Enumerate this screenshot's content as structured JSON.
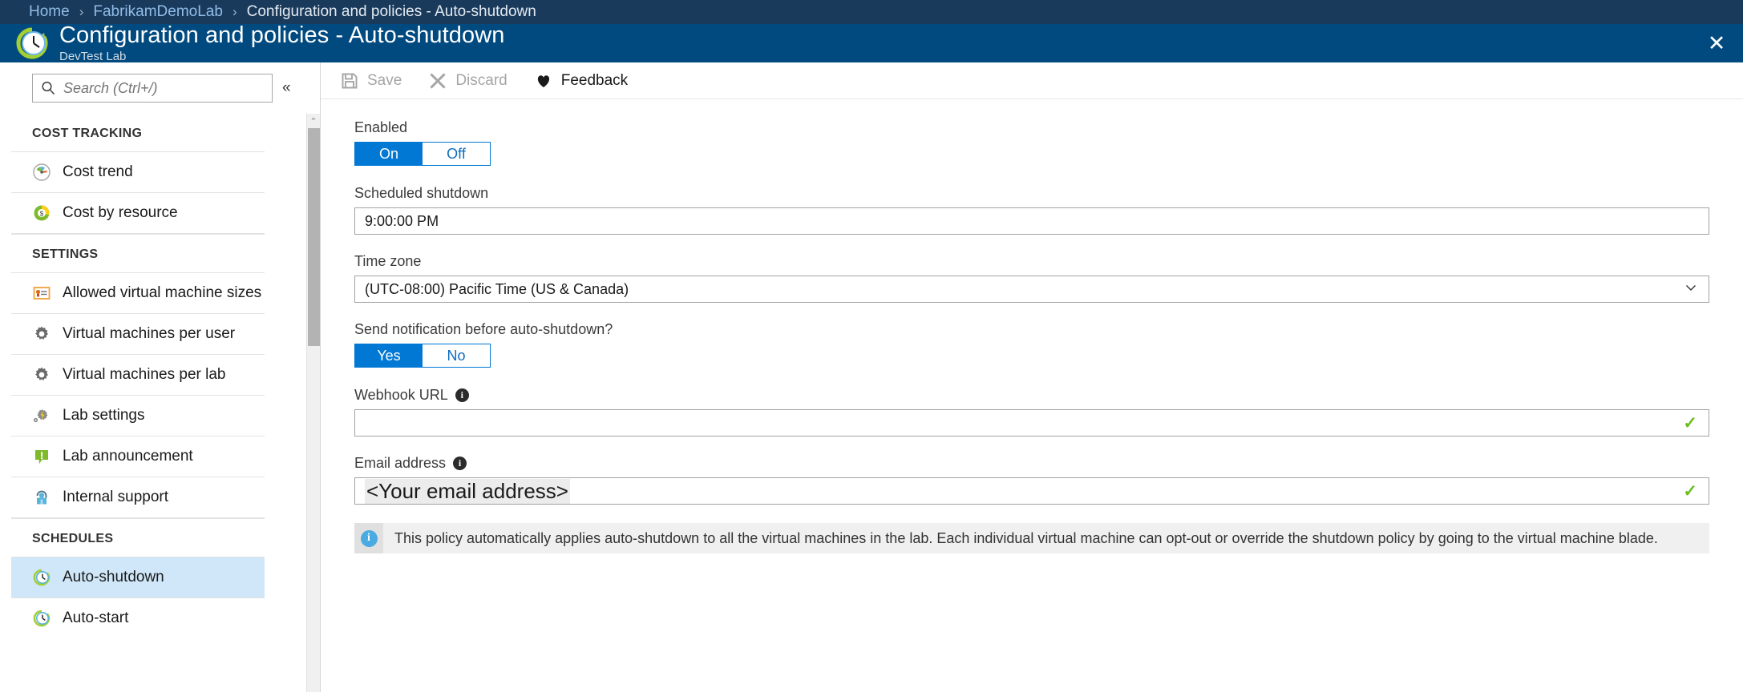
{
  "breadcrumb": {
    "items": [
      "Home",
      "FabrikamDemoLab",
      "Configuration and policies - Auto-shutdown"
    ],
    "separator": "›"
  },
  "header": {
    "title": "Configuration and policies - Auto-shutdown",
    "subtitle": "DevTest Lab",
    "icon": "clock-refresh-icon",
    "close_label": "✕"
  },
  "sidebar": {
    "search": {
      "placeholder": "Search (Ctrl+/)",
      "value": "",
      "icon": "search-icon"
    },
    "collapse_label": "«",
    "scroll_up_label": "⌃",
    "groups": [
      {
        "title": "COST TRACKING",
        "items": [
          {
            "label": "Cost trend",
            "icon": "cost-trend-icon",
            "selected": false
          },
          {
            "label": "Cost by resource",
            "icon": "cost-by-resource-icon",
            "selected": false
          }
        ]
      },
      {
        "title": "SETTINGS",
        "items": [
          {
            "label": "Allowed virtual machine sizes",
            "icon": "certificate-icon",
            "selected": false
          },
          {
            "label": "Virtual machines per user",
            "icon": "gear-icon",
            "selected": false
          },
          {
            "label": "Virtual machines per lab",
            "icon": "gear-icon",
            "selected": false
          },
          {
            "label": "Lab settings",
            "icon": "lab-settings-icon",
            "selected": false
          },
          {
            "label": "Lab announcement",
            "icon": "announcement-icon",
            "selected": false
          },
          {
            "label": "Internal support",
            "icon": "support-icon",
            "selected": false
          }
        ]
      },
      {
        "title": "SCHEDULES",
        "items": [
          {
            "label": "Auto-shutdown",
            "icon": "clock-refresh-icon",
            "selected": true
          },
          {
            "label": "Auto-start",
            "icon": "clock-refresh-icon",
            "selected": false
          }
        ]
      }
    ]
  },
  "commandbar": {
    "items": [
      {
        "label": "Save",
        "icon": "save-icon",
        "enabled": false
      },
      {
        "label": "Discard",
        "icon": "discard-icon",
        "enabled": false
      },
      {
        "label": "Feedback",
        "icon": "heart-icon",
        "enabled": true
      }
    ]
  },
  "form": {
    "enabled": {
      "label": "Enabled",
      "options": [
        "On",
        "Off"
      ],
      "selected": "On"
    },
    "scheduled_shutdown": {
      "label": "Scheduled shutdown",
      "value": "9:00:00 PM"
    },
    "time_zone": {
      "label": "Time zone",
      "value": "(UTC-08:00) Pacific Time (US & Canada)",
      "chevron": "⌄"
    },
    "send_notification": {
      "label": "Send notification before auto-shutdown?",
      "options": [
        "Yes",
        "No"
      ],
      "selected": "Yes"
    },
    "webhook_url": {
      "label": "Webhook URL",
      "info": "i",
      "value": "",
      "valid_mark": "✓"
    },
    "email_address": {
      "label": "Email address",
      "info": "i",
      "value": "<Your email address>",
      "valid_mark": "✓"
    },
    "info_banner": {
      "icon": "info-icon",
      "text": "This policy automatically applies auto-shutdown to all the virtual machines in the lab. Each individual virtual machine can opt-out or override the shutdown policy by going to the virtual machine blade."
    }
  },
  "colors": {
    "breadcrumb_bg": "#1a3a5c",
    "header_bg": "#014a80",
    "accent_blue": "#0078d4",
    "selected_nav": "#cfe7f8",
    "valid_green": "#6cbe1e",
    "info_blue": "#4aabe3"
  }
}
